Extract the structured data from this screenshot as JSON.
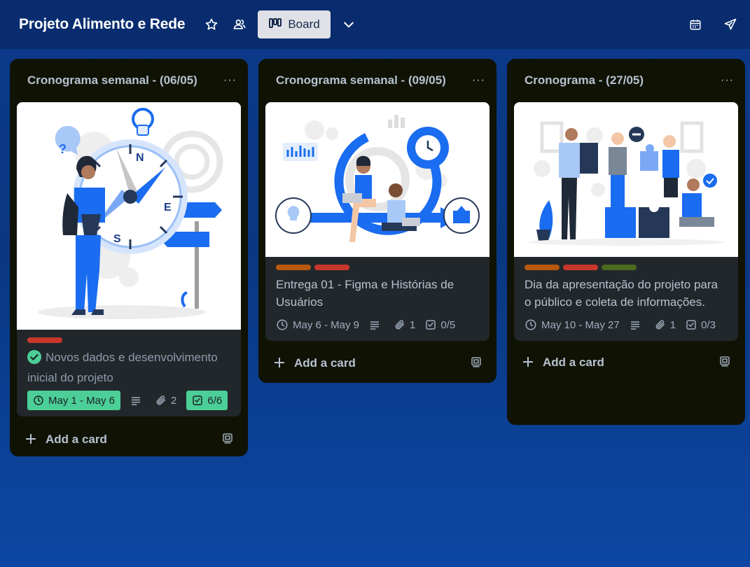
{
  "board": {
    "title": "Projeto Alimento e Rede",
    "view_label": "Board"
  },
  "icons": {
    "star": "star-icon",
    "visibility": "workspace-visible-icon",
    "board_view": "board-view-icon",
    "chevron": "chevron-down-icon",
    "calendar": "calendar-icon",
    "rocket": "power-ups-icon"
  },
  "colors": {
    "label_orange": "#b6580e",
    "label_red": "#c9372c",
    "label_green": "#4c6b1f",
    "badge_green": "#4bce97"
  },
  "lists": [
    {
      "title": "Cronograma semanal - (06/05)",
      "menu": "···",
      "add_card": "Add a card",
      "cards": [
        {
          "title": "Novos dados e desenvolvimento inicial do projeto",
          "dates": "May 1 - May 6",
          "attachments": "2",
          "checklist": "6/6"
        }
      ]
    },
    {
      "title": "Cronograma semanal - (09/05)",
      "menu": "···",
      "add_card": "Add a card",
      "cards": [
        {
          "title": "Entrega 01 - Figma e Histórias de Usuários",
          "dates": "May 6 - May 9",
          "attachments": "1",
          "checklist": "0/5"
        }
      ]
    },
    {
      "title": "Cronograma - (27/05)",
      "menu": "···",
      "add_card": "Add a card",
      "cards": [
        {
          "title": "Dia da apresentação do projeto para o público e coleta de informações.",
          "dates": "May 10 - May 27",
          "attachments": "1",
          "checklist": "0/3"
        }
      ]
    }
  ]
}
